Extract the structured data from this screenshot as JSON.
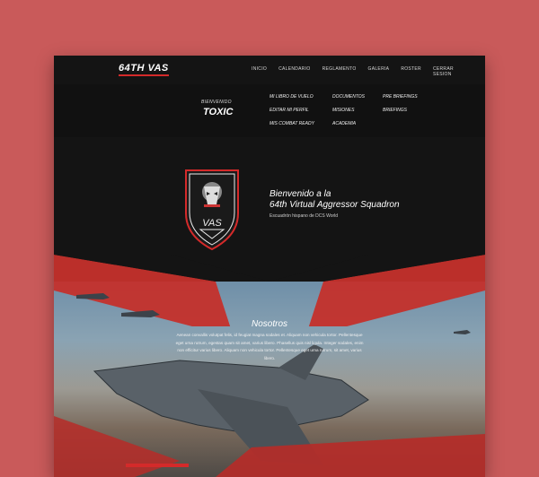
{
  "brand": {
    "logo_text": "64TH VAS"
  },
  "nav": {
    "items": [
      "INICIO",
      "CALENDARIO",
      "REGLAMENTO",
      "GALERIA",
      "ROSTER",
      "CERRAR SESION"
    ]
  },
  "user": {
    "welcome_label": "BIENVENIDO",
    "name": "TOXIC"
  },
  "submenu": {
    "col1": [
      "MI LIBRO DE VUELO",
      "EDITAR MI PERFIL",
      "MIS COMBAT READY"
    ],
    "col2": [
      "DOCUMENTOS",
      "MISIONES",
      "ACADEMIA"
    ],
    "col3": [
      "PRE BRIEFINGS",
      "BRIEFINGS"
    ]
  },
  "hero": {
    "title_line1": "Bienvenido a la",
    "title_line2": "64th Virtual Aggressor Squadron",
    "subtitle": "Escuadrón hispano de DCS World"
  },
  "emblem": {
    "text": "VAS"
  },
  "about": {
    "title": "Nosotros",
    "text": "Aenean convallis volutpat felis, id feugiat magna sodales et. Aliquam non vehicula tortor. Pellentesque eget urna rutrum, egestas quam sit amet, varius libero. Phasellus quis nisl ligula. Integer sodales, enim non efficitur varius libero. Aliquam non vehicula tortor. Pellentesque eget urna rutrum, sit amet, varius libero."
  },
  "colors": {
    "accent": "#b11e1e",
    "background": "#141414",
    "frame": "#c95a5a"
  }
}
